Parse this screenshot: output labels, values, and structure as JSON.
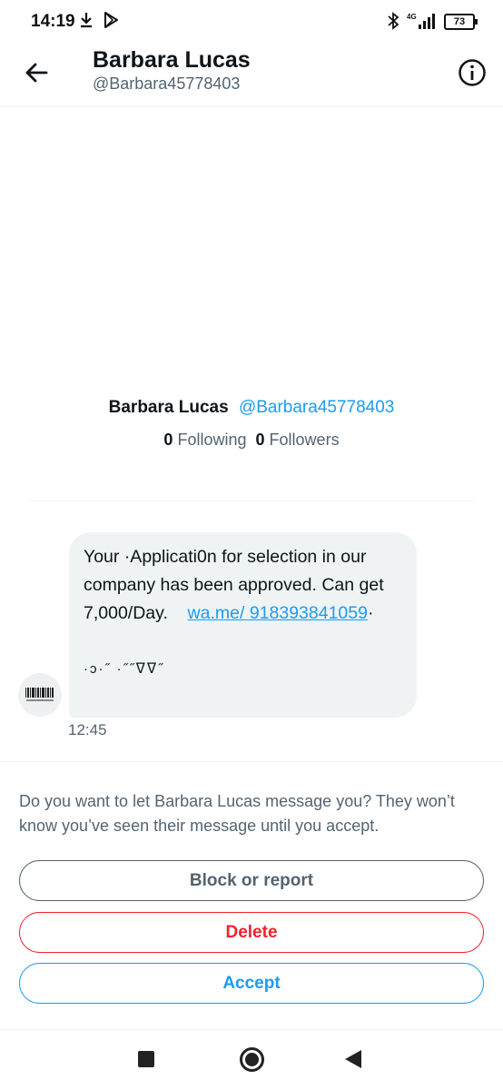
{
  "status_bar": {
    "time": "14:19",
    "network": "4G",
    "battery": "73",
    "icons": [
      "download-icon",
      "play-store-icon",
      "bluetooth-icon",
      "signal-icon",
      "battery-icon"
    ]
  },
  "header": {
    "name": "Barbara Lucas",
    "handle": "@Barbara45778403",
    "back_icon": "arrow-left-icon",
    "info_icon": "info-icon"
  },
  "profile": {
    "name": "Barbara Lucas",
    "handle": "@Barbara45778403",
    "following_count": "0",
    "following_label": "Following",
    "followers_count": "0",
    "followers_label": "Followers"
  },
  "message": {
    "text": "Your  ·Applicati0n for selection in our company has been approved. Can get 7,000/Day.",
    "link_part1": "wa.me/",
    "link_part2": "918393841059",
    "trailing": "·",
    "kaomoji": "·ͻ·˝ ·˝˝ᐁᐁ˝",
    "time": "12:45"
  },
  "request": {
    "text": "Do you want to let Barbara Lucas message you? They won’t know you’ve seen their message until you accept.",
    "block_label": "Block or report",
    "delete_label": "Delete",
    "accept_label": "Accept"
  },
  "colors": {
    "accent": "#1d9bf0",
    "danger": "#f4212e",
    "muted": "#536471",
    "bubble": "#eff3f4"
  }
}
